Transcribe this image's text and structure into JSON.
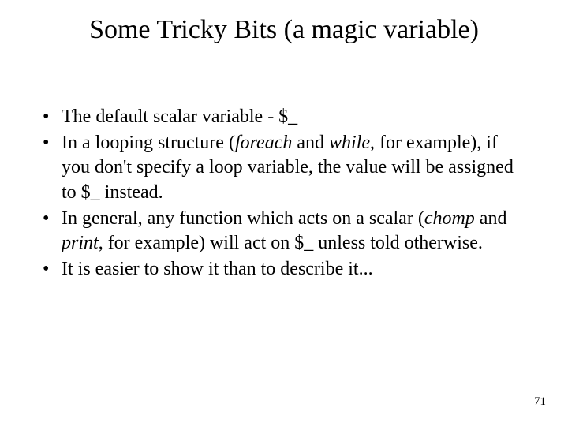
{
  "title": "Some Tricky Bits (a magic variable)",
  "bullets": {
    "b1": "The default scalar variable - $_",
    "b2a": "In a looping structure (",
    "b2b_i": "foreach",
    "b2c": " and ",
    "b2d_i": "while",
    "b2e": ", for example), if you don't specify a loop variable, the value will be assigned to $_ instead.",
    "b3a": "In general, any function which acts on a scalar (",
    "b3b_i": "chomp",
    "b3c": " and ",
    "b3d_i": "print",
    "b3e": ", for example) will act on $_ unless told otherwise.",
    "b4": "It is easier to show it than to describe it..."
  },
  "page_number": "71"
}
